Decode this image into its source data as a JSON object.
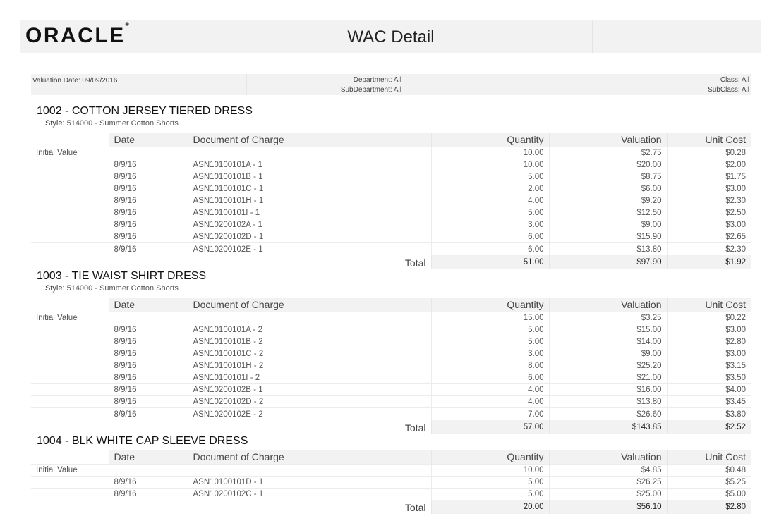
{
  "header": {
    "logo_text": "ORACLE",
    "logo_mark": "®",
    "title": "WAC Detail"
  },
  "params": {
    "valuation_date": "Valuation Date: 09/09/2016",
    "department": "Department:  All",
    "subdepartment": "SubDepartment: All",
    "class": "Class: All",
    "subclass": "SubClass: All"
  },
  "columns": {
    "date": "Date",
    "document": "Document of Charge",
    "quantity": "Quantity",
    "valuation": "Valuation",
    "unit_cost": "Unit Cost"
  },
  "total_label": "Total",
  "style_label": "Style:",
  "sections": [
    {
      "title": "1002 - COTTON JERSEY TIERED DRESS",
      "style": "514000 - Summer Cotton Shorts",
      "rows": [
        {
          "label": "Initial Value",
          "date": "",
          "doc": "",
          "qty": "10.00",
          "val": "$2.75",
          "unit": "$0.28"
        },
        {
          "label": "",
          "date": "8/9/16",
          "doc": "ASN10100101A - 1",
          "qty": "10.00",
          "val": "$20.00",
          "unit": "$2.00"
        },
        {
          "label": "",
          "date": "8/9/16",
          "doc": "ASN10100101B - 1",
          "qty": "5.00",
          "val": "$8.75",
          "unit": "$1.75"
        },
        {
          "label": "",
          "date": "8/9/16",
          "doc": "ASN10100101C - 1",
          "qty": "2.00",
          "val": "$6.00",
          "unit": "$3.00"
        },
        {
          "label": "",
          "date": "8/9/16",
          "doc": "ASN10100101H - 1",
          "qty": "4.00",
          "val": "$9.20",
          "unit": "$2.30"
        },
        {
          "label": "",
          "date": "8/9/16",
          "doc": "ASN10100101I - 1",
          "qty": "5.00",
          "val": "$12.50",
          "unit": "$2.50"
        },
        {
          "label": "",
          "date": "8/9/16",
          "doc": "ASN10200102A - 1",
          "qty": "3.00",
          "val": "$9.00",
          "unit": "$3.00"
        },
        {
          "label": "",
          "date": "8/9/16",
          "doc": "ASN10200102D - 1",
          "qty": "6.00",
          "val": "$15.90",
          "unit": "$2.65"
        },
        {
          "label": "",
          "date": "8/9/16",
          "doc": "ASN10200102E - 1",
          "qty": "6.00",
          "val": "$13.80",
          "unit": "$2.30"
        }
      ],
      "total": {
        "qty": "51.00",
        "val": "$97.90",
        "unit": "$1.92"
      }
    },
    {
      "title": "1003 - TIE WAIST SHIRT DRESS",
      "style": "514000 - Summer Cotton Shorts",
      "rows": [
        {
          "label": "Initial Value",
          "date": "",
          "doc": "",
          "qty": "15.00",
          "val": "$3.25",
          "unit": "$0.22"
        },
        {
          "label": "",
          "date": "8/9/16",
          "doc": "ASN10100101A - 2",
          "qty": "5.00",
          "val": "$15.00",
          "unit": "$3.00"
        },
        {
          "label": "",
          "date": "8/9/16",
          "doc": "ASN10100101B - 2",
          "qty": "5.00",
          "val": "$14.00",
          "unit": "$2.80"
        },
        {
          "label": "",
          "date": "8/9/16",
          "doc": "ASN10100101C - 2",
          "qty": "3.00",
          "val": "$9.00",
          "unit": "$3.00"
        },
        {
          "label": "",
          "date": "8/9/16",
          "doc": "ASN10100101H - 2",
          "qty": "8.00",
          "val": "$25.20",
          "unit": "$3.15"
        },
        {
          "label": "",
          "date": "8/9/16",
          "doc": "ASN10100101I - 2",
          "qty": "6.00",
          "val": "$21.00",
          "unit": "$3.50"
        },
        {
          "label": "",
          "date": "8/9/16",
          "doc": "ASN10200102B - 1",
          "qty": "4.00",
          "val": "$16.00",
          "unit": "$4.00"
        },
        {
          "label": "",
          "date": "8/9/16",
          "doc": "ASN10200102D - 2",
          "qty": "4.00",
          "val": "$13.80",
          "unit": "$3.45"
        },
        {
          "label": "",
          "date": "8/9/16",
          "doc": "ASN10200102E - 2",
          "qty": "7.00",
          "val": "$26.60",
          "unit": "$3.80"
        }
      ],
      "total": {
        "qty": "57.00",
        "val": "$143.85",
        "unit": "$2.52"
      }
    },
    {
      "title": "1004 - BLK WHITE CAP SLEEVE DRESS",
      "style": "",
      "rows": [
        {
          "label": "Initial Value",
          "date": "",
          "doc": "",
          "qty": "10.00",
          "val": "$4.85",
          "unit": "$0.48"
        },
        {
          "label": "",
          "date": "8/9/16",
          "doc": "ASN10100101D - 1",
          "qty": "5.00",
          "val": "$26.25",
          "unit": "$5.25"
        },
        {
          "label": "",
          "date": "8/9/16",
          "doc": "ASN10200102C - 1",
          "qty": "5.00",
          "val": "$25.00",
          "unit": "$5.00"
        }
      ],
      "total": {
        "qty": "20.00",
        "val": "$56.10",
        "unit": "$2.80"
      }
    }
  ]
}
